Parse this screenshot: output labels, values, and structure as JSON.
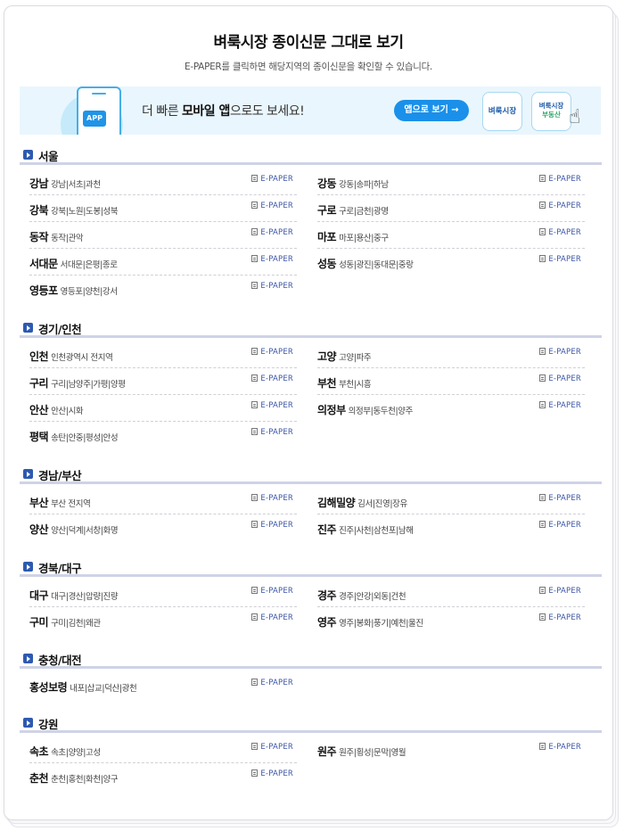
{
  "header": {
    "title": "벼룩시장 종이신문 그대로 보기",
    "subtitle": "E-PAPER를 클릭하면 해당지역의 종이신문을 확인할 수 있습니다."
  },
  "banner": {
    "app_badge": "APP",
    "text_prefix": "더 빠른 ",
    "text_bold": "모바일 앱",
    "text_suffix": "으로도 보세요!",
    "app_button": "앱으로 보기 →",
    "brand_button": "벼룩시장",
    "realestate_line1": "벼룩시장",
    "realestate_line2": "부동산"
  },
  "epaper_label": "E-PAPER",
  "sections": [
    {
      "title": "서울",
      "items": [
        {
          "city": "강남",
          "areas": "강남|서초|과천"
        },
        {
          "city": "강동",
          "areas": "강동|송파|하남"
        },
        {
          "city": "강북",
          "areas": "강북|노원|도봉|성북"
        },
        {
          "city": "구로",
          "areas": "구로|금천|광명"
        },
        {
          "city": "동작",
          "areas": "동작|관악"
        },
        {
          "city": "마포",
          "areas": "마포|용산|중구"
        },
        {
          "city": "서대문",
          "areas": "서대문|은평|종로"
        },
        {
          "city": "성동",
          "areas": "성동|광진|동대문|중랑"
        },
        {
          "city": "영등포",
          "areas": "영등포|양천|강서"
        }
      ]
    },
    {
      "title": "경기/인천",
      "items": [
        {
          "city": "인천",
          "areas": "인천광역시 전지역"
        },
        {
          "city": "고양",
          "areas": "고양|파주"
        },
        {
          "city": "구리",
          "areas": "구리|남양주|가평|양평"
        },
        {
          "city": "부천",
          "areas": "부천|시흥"
        },
        {
          "city": "안산",
          "areas": "안산|시화"
        },
        {
          "city": "의정부",
          "areas": "의정부|동두천|양주"
        },
        {
          "city": "평택",
          "areas": "송탄|안중|평성|안성"
        }
      ]
    },
    {
      "title": "경남/부산",
      "items": [
        {
          "city": "부산",
          "areas": "부산 전지역"
        },
        {
          "city": "김해밀양",
          "areas": "김서|진영|장유"
        },
        {
          "city": "양산",
          "areas": "양산|덕계|서창|화명"
        },
        {
          "city": "진주",
          "areas": "진주|사천|삼천포|남해"
        }
      ]
    },
    {
      "title": "경북/대구",
      "items": [
        {
          "city": "대구",
          "areas": "대구|경산|압량|진량"
        },
        {
          "city": "경주",
          "areas": "경주|안강|외동|건천"
        },
        {
          "city": "구미",
          "areas": "구미|김천|왜관"
        },
        {
          "city": "영주",
          "areas": "영주|봉화|풍기|예천|울진"
        }
      ]
    },
    {
      "title": "충청/대전",
      "items": [
        {
          "city": "홍성보령",
          "areas": "내포|삽교|덕산|광천"
        }
      ]
    },
    {
      "title": "강원",
      "items": [
        {
          "city": "속초",
          "areas": "속초|양양|고성"
        },
        {
          "city": "원주",
          "areas": "원주|횡성|문막|영월"
        },
        {
          "city": "춘천",
          "areas": "춘천|홍천|화천|양구"
        }
      ]
    }
  ]
}
